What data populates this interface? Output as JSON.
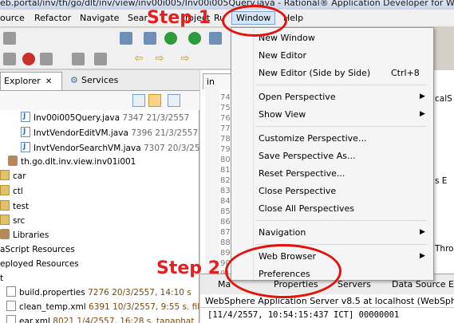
{
  "window": {
    "title": "eb.portal/inv/th/go/dlt/inv/view/inv00i005/Inv00i005Query.java - Rational® Application Developer for WebSp"
  },
  "menubar": {
    "items": [
      "ource",
      "Refactor",
      "Navigate",
      "Sear",
      "roject",
      "Ru",
      "Window",
      "Help"
    ],
    "active": "Window"
  },
  "explorer": {
    "tabs": {
      "active_label": "Explorer",
      "close_glyph": "✕",
      "second_label": "Services"
    },
    "rows": [
      {
        "name": "Inv00i005Query.java",
        "meta": "7347  21/3/2557"
      },
      {
        "name": "InvtVendorEditVM.java",
        "meta": "7396  21/3/2557"
      },
      {
        "name": "InvtVendorSearchVM.java",
        "meta": "7307  20/3/2557"
      },
      {
        "name": "th.go.dlt.inv.view.inv01i001",
        "meta": ""
      },
      {
        "name": "car",
        "meta": ""
      },
      {
        "name": "ctl",
        "meta": ""
      },
      {
        "name": "test",
        "meta": ""
      },
      {
        "name": "src",
        "meta": ""
      },
      {
        "name": "Libraries",
        "meta": ""
      },
      {
        "name": "aScript Resources",
        "meta": ""
      },
      {
        "name": "eployed Resources",
        "meta": ""
      },
      {
        "name": "t",
        "meta": ""
      },
      {
        "name": "build.properties",
        "meta": "7276  20/3/2557, 14:10  s"
      },
      {
        "name": "clean_temp.xml",
        "meta": "6391  10/3/2557, 9:55  s.  fil"
      },
      {
        "name": "ear.xml",
        "meta": "8021  1/4/2557, 16:28  s.  tanaphat"
      }
    ]
  },
  "editor": {
    "tab_label": "in",
    "line_numbers": [
      "74",
      "75",
      "76",
      "77",
      "78",
      "79",
      "80",
      "81",
      "82",
      "83",
      "84",
      "85",
      "86",
      "87",
      "88",
      "89",
      "90",
      "91"
    ],
    "code_fragments": [
      "calS",
      "s E",
      "Thro"
    ]
  },
  "dropdown": {
    "items": [
      {
        "label": "New Window",
        "accel": "",
        "submenu": false
      },
      {
        "label": "New Editor",
        "accel": "",
        "submenu": false
      },
      {
        "label": "New Editor (Side by Side)",
        "accel": "Ctrl+8",
        "submenu": false
      },
      {
        "label": "Open Perspective",
        "accel": "",
        "submenu": true
      },
      {
        "label": "Show View",
        "accel": "",
        "submenu": true
      },
      {
        "label": "Customize Perspective...",
        "accel": "",
        "submenu": false
      },
      {
        "label": "Save Perspective As...",
        "accel": "",
        "submenu": false
      },
      {
        "label": "Reset Perspective...",
        "accel": "",
        "submenu": false
      },
      {
        "label": "Close Perspective",
        "accel": "",
        "submenu": false
      },
      {
        "label": "Close All Perspectives",
        "accel": "",
        "submenu": false
      },
      {
        "label": "Navigation",
        "accel": "",
        "submenu": true
      },
      {
        "label": "Web Browser",
        "accel": "",
        "submenu": true
      },
      {
        "label": "Preferences",
        "accel": "",
        "submenu": false
      }
    ],
    "submenu_glyph": "▶"
  },
  "console": {
    "tabs": [
      "Ma",
      "Properties",
      "Servers",
      "Data Source Ex"
    ],
    "header": "WebSphere Application Server v8.5 at localhost (WebSphere",
    "line": "[11/4/2557, 10:54:15:437 ICT] 00000001"
  },
  "annotations": {
    "step1": "Step 1",
    "step2": "Step 2",
    "color": "#e3120c"
  }
}
